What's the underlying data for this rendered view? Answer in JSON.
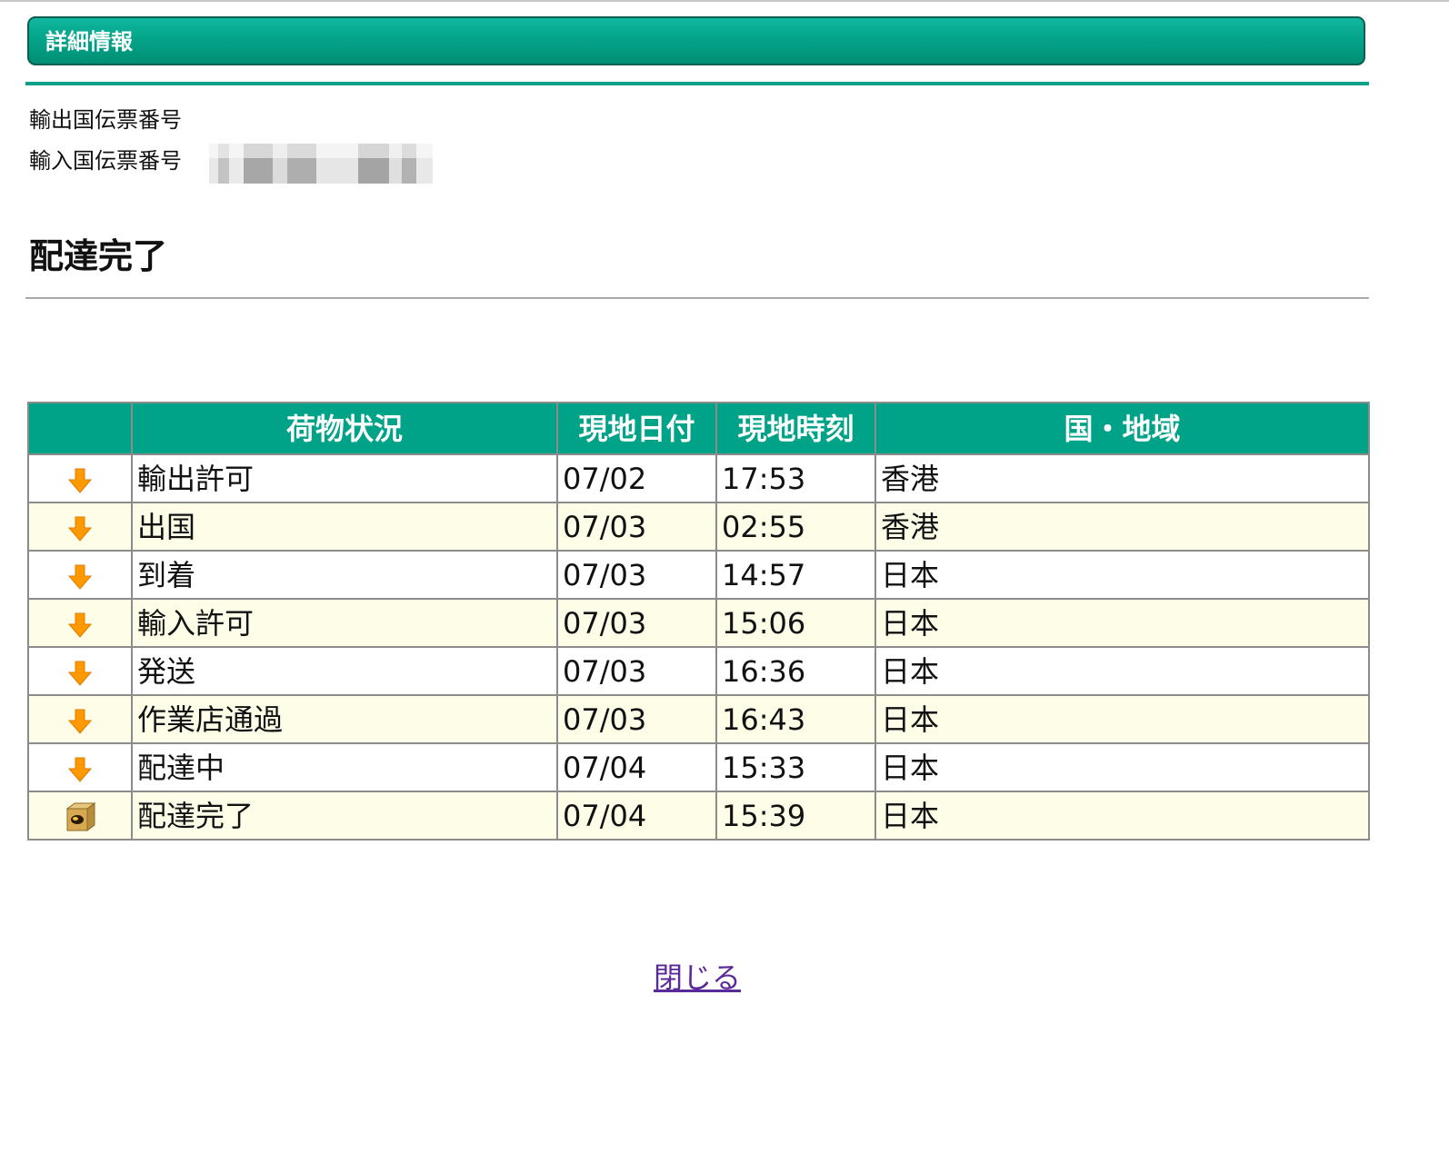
{
  "banner": {
    "title": "詳細情報"
  },
  "refs": {
    "export_label": "輸出国伝票番号",
    "import_label": "輸入国伝票番号"
  },
  "status": "配達完了",
  "table": {
    "headers": [
      "",
      "荷物状況",
      "現地日付",
      "現地時刻",
      "国・地域"
    ],
    "rows": [
      {
        "icon": "down-arrow-icon",
        "status": "輸出許可",
        "date": "07/02",
        "time": "17:53",
        "region": "香港"
      },
      {
        "icon": "down-arrow-icon",
        "status": "出国",
        "date": "07/03",
        "time": "02:55",
        "region": "香港"
      },
      {
        "icon": "down-arrow-icon",
        "status": "到着",
        "date": "07/03",
        "time": "14:57",
        "region": "日本"
      },
      {
        "icon": "down-arrow-icon",
        "status": "輸入許可",
        "date": "07/03",
        "time": "15:06",
        "region": "日本"
      },
      {
        "icon": "down-arrow-icon",
        "status": "発送",
        "date": "07/03",
        "time": "16:36",
        "region": "日本"
      },
      {
        "icon": "down-arrow-icon",
        "status": "作業店通過",
        "date": "07/03",
        "time": "16:43",
        "region": "日本"
      },
      {
        "icon": "down-arrow-icon",
        "status": "配達中",
        "date": "07/04",
        "time": "15:33",
        "region": "日本"
      },
      {
        "icon": "delivered-box-icon",
        "status": "配達完了",
        "date": "07/04",
        "time": "15:39",
        "region": "日本"
      }
    ]
  },
  "footer": {
    "close_label": "閉じる"
  },
  "colors": {
    "accent": "#00a388",
    "arrow": "#ff9900",
    "row_alt": "#fefee8",
    "link": "#5b2a9a"
  }
}
